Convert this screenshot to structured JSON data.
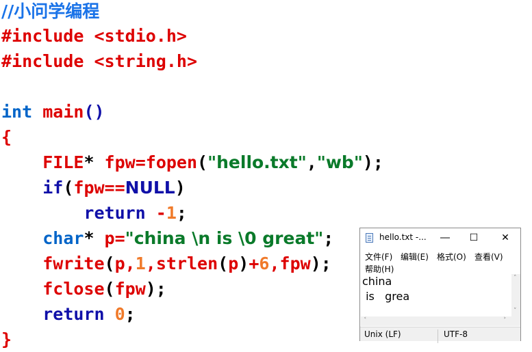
{
  "code": {
    "comment": "//小问学编程",
    "include1": [
      "#include",
      " ",
      "<stdio.h>"
    ],
    "include2": [
      "#include",
      " ",
      "<string.h>"
    ],
    "line_main": [
      "int",
      " ",
      "main",
      "()"
    ],
    "open_brace": "{",
    "line_fopen": [
      "    ",
      "FILE",
      "* ",
      "fpw",
      "=",
      "fopen",
      "(",
      "\"hello.txt\"",
      ",",
      "\"wb\"",
      ");"
    ],
    "line_if": [
      "    ",
      "if",
      "(",
      "fpw",
      "==",
      "NULL",
      ")"
    ],
    "line_return1": [
      "        ",
      "return",
      " ",
      "-",
      "1",
      ";"
    ],
    "line_char": [
      "    ",
      "char",
      "* ",
      "p",
      "=",
      "\"china \\n is \\0 great\"",
      ";"
    ],
    "line_fwrite": [
      "    ",
      "fwrite",
      "(",
      "p",
      ",",
      "1",
      ",",
      "strlen",
      "(",
      "p",
      ")",
      "+",
      "6",
      ",",
      "fpw",
      ");"
    ],
    "line_fclose": [
      "    ",
      "fclose",
      "(",
      "fpw",
      ");"
    ],
    "line_return0": [
      "    ",
      "return",
      " ",
      "0",
      ";"
    ],
    "close_brace": "}"
  },
  "notepad": {
    "title": "hello.txt -...",
    "menu": [
      "文件(F)",
      "编辑(E)",
      "格式(O)",
      "查看(V)",
      "帮助(H)"
    ],
    "content_lines": [
      "china",
      " is   grea"
    ],
    "status_line_ending": "Unix (LF)",
    "status_encoding": "UTF-8",
    "icons": [
      "notepad-document-icon",
      "minimize-icon",
      "maximize-icon",
      "close-icon"
    ]
  }
}
